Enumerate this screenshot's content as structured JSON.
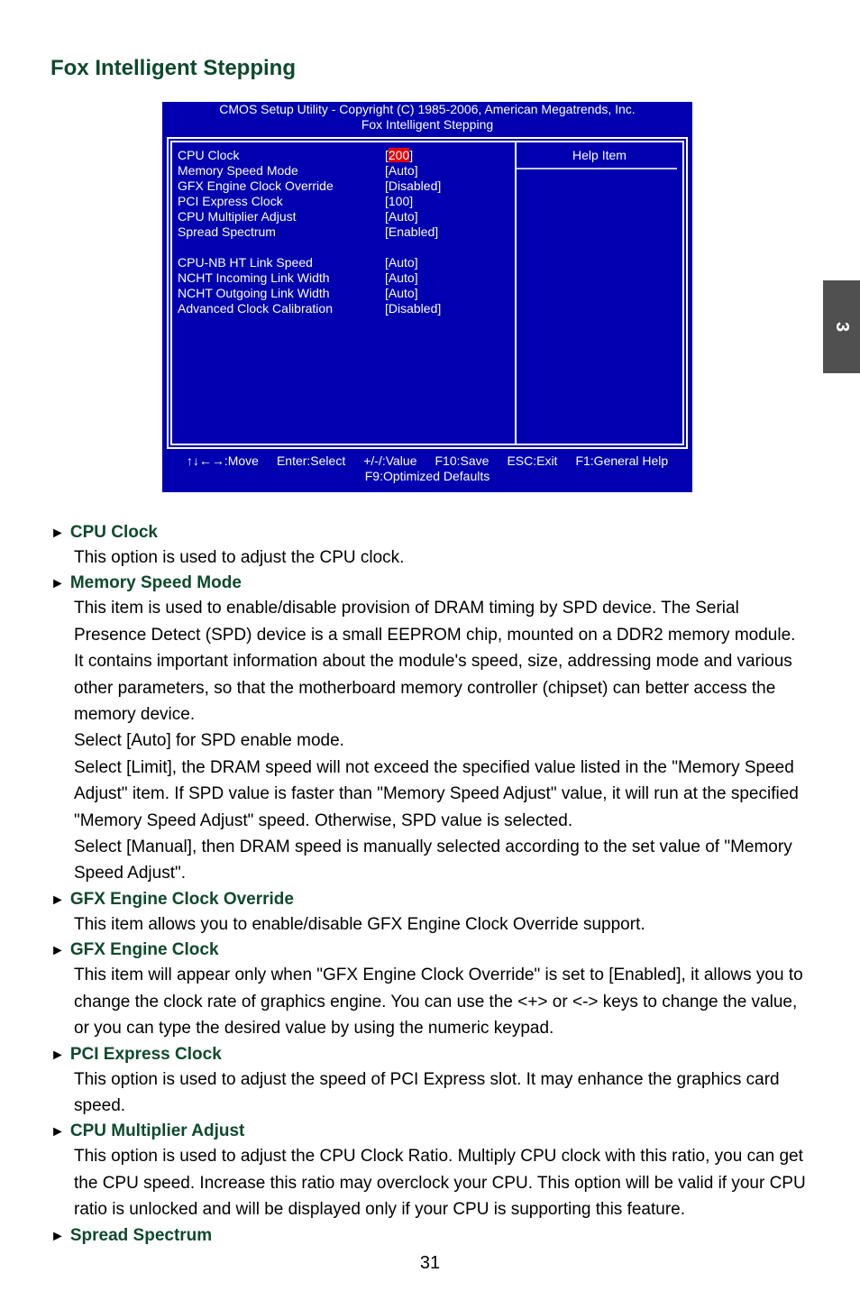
{
  "page": {
    "title": "Fox Intelligent Stepping",
    "chapter_tab": "3",
    "page_number": "31"
  },
  "bios": {
    "header_line1": "CMOS Setup Utility - Copyright (C) 1985-2006, American Megatrends, Inc.",
    "header_line2": "Fox Intelligent Stepping",
    "help_title": "Help Item",
    "items_group1": [
      {
        "label": "CPU Clock",
        "value_prefix": "[",
        "value": "200",
        "value_suffix": "]",
        "selected": true
      },
      {
        "label": "Memory Speed Mode",
        "value": "[Auto]"
      },
      {
        "label": "GFX Engine Clock Override",
        "value": "[Disabled]"
      },
      {
        "label": "PCI Express Clock",
        "value": "[100]"
      },
      {
        "label": "CPU Multiplier Adjust",
        "value": "[Auto]"
      },
      {
        "label": "Spread Spectrum",
        "value": "[Enabled]"
      }
    ],
    "items_group2": [
      {
        "label": "CPU-NB HT Link Speed",
        "value": "[Auto]"
      },
      {
        "label": "NCHT Incoming Link Width",
        "value": "[Auto]"
      },
      {
        "label": "NCHT Outgoing Link Width",
        "value": "[Auto]"
      },
      {
        "label": "Advanced Clock Calibration",
        "value": "[Disabled]"
      }
    ],
    "footer_keys": [
      "↑↓←→:Move",
      "Enter:Select",
      "+/-/:Value",
      "F10:Save",
      "ESC:Exit",
      "F1:General Help"
    ],
    "footer_line2": "F9:Optimized Defaults",
    "colors": {
      "background": "#0000b0",
      "highlight": "#e60000",
      "text": "#ffffff"
    }
  },
  "sections": [
    {
      "heading": "CPU Clock",
      "paragraphs": [
        "This option is used to adjust the CPU clock."
      ]
    },
    {
      "heading": "Memory Speed Mode",
      "paragraphs": [
        "This item is used to enable/disable provision of DRAM timing by SPD device. The Serial Presence Detect (SPD) device is a small EEPROM chip, mounted on a DDR2 memory module. It contains important information about the module's speed, size, addressing mode and various other parameters, so that the motherboard memory controller (chipset) can better access the memory device.",
        "Select [Auto] for SPD enable mode.",
        "Select [Limit], the DRAM speed will not exceed the specified value listed in the \"Memory Speed Adjust\" item. If SPD value is faster than \"Memory Speed Adjust\" value, it will run at the specified \"Memory Speed Adjust\" speed. Otherwise, SPD value is selected.",
        "Select [Manual], then DRAM speed is manually selected according to the set value of \"Memory Speed Adjust\"."
      ]
    },
    {
      "heading": "GFX Engine Clock Override",
      "paragraphs": [
        "This item allows you to enable/disable GFX Engine Clock Override support."
      ]
    },
    {
      "heading": "GFX Engine Clock",
      "paragraphs": [
        "This item will appear only when \"GFX Engine Clock Override\" is set to [Enabled], it allows you to change the clock rate of graphics engine. You can use the <+> or <-> keys to change the value, or you can type the desired value by using the numeric keypad."
      ]
    },
    {
      "heading": "PCI Express Clock",
      "paragraphs": [
        "This option is used to adjust the speed of PCI Express slot. It may enhance the graphics card speed."
      ]
    },
    {
      "heading": "CPU Multiplier Adjust",
      "paragraphs": [
        "This option is used to adjust the CPU Clock Ratio. Multiply CPU clock with this ratio, you can get the CPU speed. Increase this ratio may overclock your CPU. This option will be valid if your CPU ratio is unlocked and will be displayed only if your CPU is supporting this feature."
      ]
    },
    {
      "heading": "Spread Spectrum",
      "paragraphs": []
    }
  ],
  "icons": {
    "bullet": "triangle-right-icon",
    "bullet_glyph": "►"
  }
}
